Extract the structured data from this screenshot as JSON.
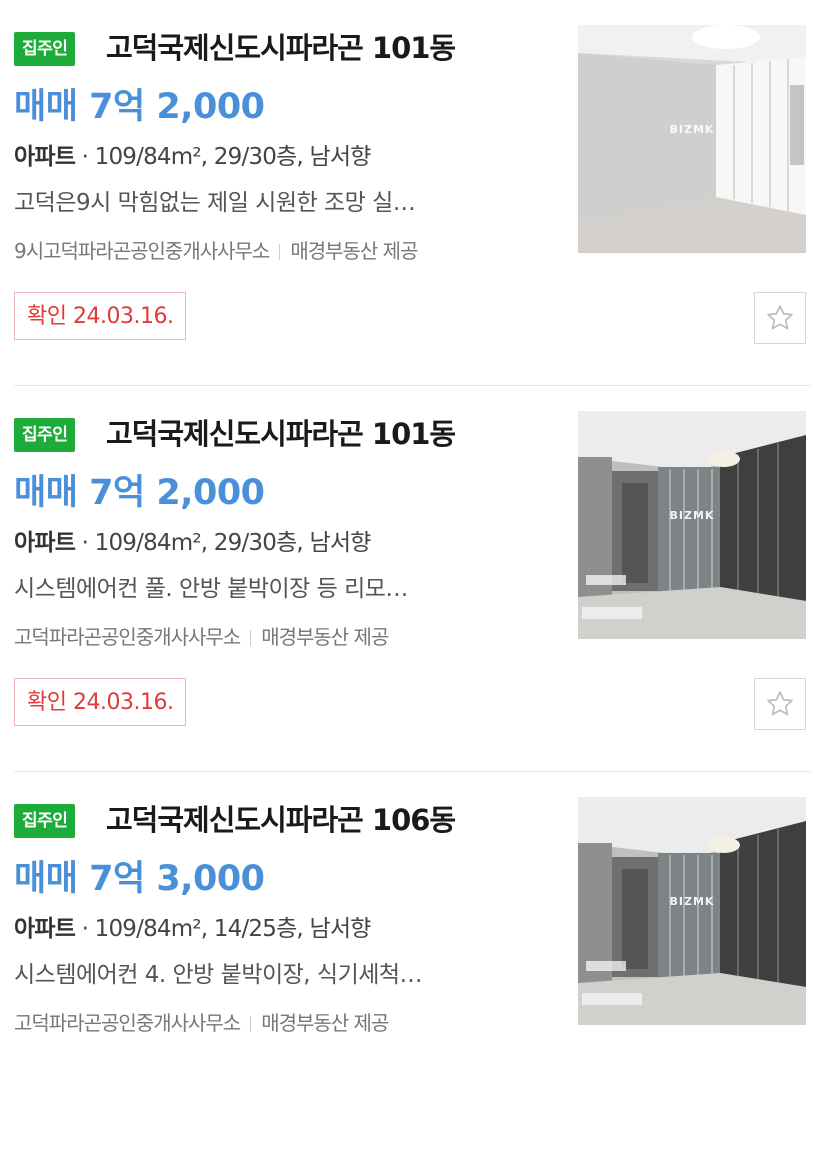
{
  "listings": [
    {
      "badge": "집주인",
      "title": "고덕국제신도시파라곤 101동",
      "price": "매매 7억 2,000",
      "type": "아파트",
      "spec": " · 109/84m², 29/30층, 남서향",
      "description": "고덕은9시 막힘없는 제일 시원한 조망 실…",
      "agent": "9시고덕파라곤공인중개사사무소",
      "provider": "매경부동산 제공",
      "confirm": "확인 24.03.16.",
      "watermark": "BIZMK",
      "photo_scene": "empty-room-white-wardrobe"
    },
    {
      "badge": "집주인",
      "title": "고덕국제신도시파라곤 101동",
      "price": "매매 7억 2,000",
      "type": "아파트",
      "spec": " · 109/84m², 29/30층, 남서향",
      "description": "시스템에어컨 풀. 안방 붙박이장 등 리모…",
      "agent": "고덕파라곤공인중개사사무소",
      "provider": "매경부동산 제공",
      "confirm": "확인 24.03.16.",
      "watermark": "BIZMK",
      "photo_scene": "living-room-glass-partition"
    },
    {
      "badge": "집주인",
      "title": "고덕국제신도시파라곤 106동",
      "price": "매매 7억 3,000",
      "type": "아파트",
      "spec": " · 109/84m², 14/25층, 남서향",
      "description": "시스템에어컨 4. 안방 붙박이장, 식기세척…",
      "agent": "고덕파라곤공인중개사사무소",
      "provider": "매경부동산 제공",
      "confirm": "",
      "watermark": "BIZMK",
      "photo_scene": "living-room-glass-partition"
    }
  ],
  "colors": {
    "badge_green": "#1dab3a",
    "price_blue": "#4a90d9",
    "confirm_red": "#e03a3a"
  },
  "icons": {
    "favorite": "star-outline-icon"
  }
}
